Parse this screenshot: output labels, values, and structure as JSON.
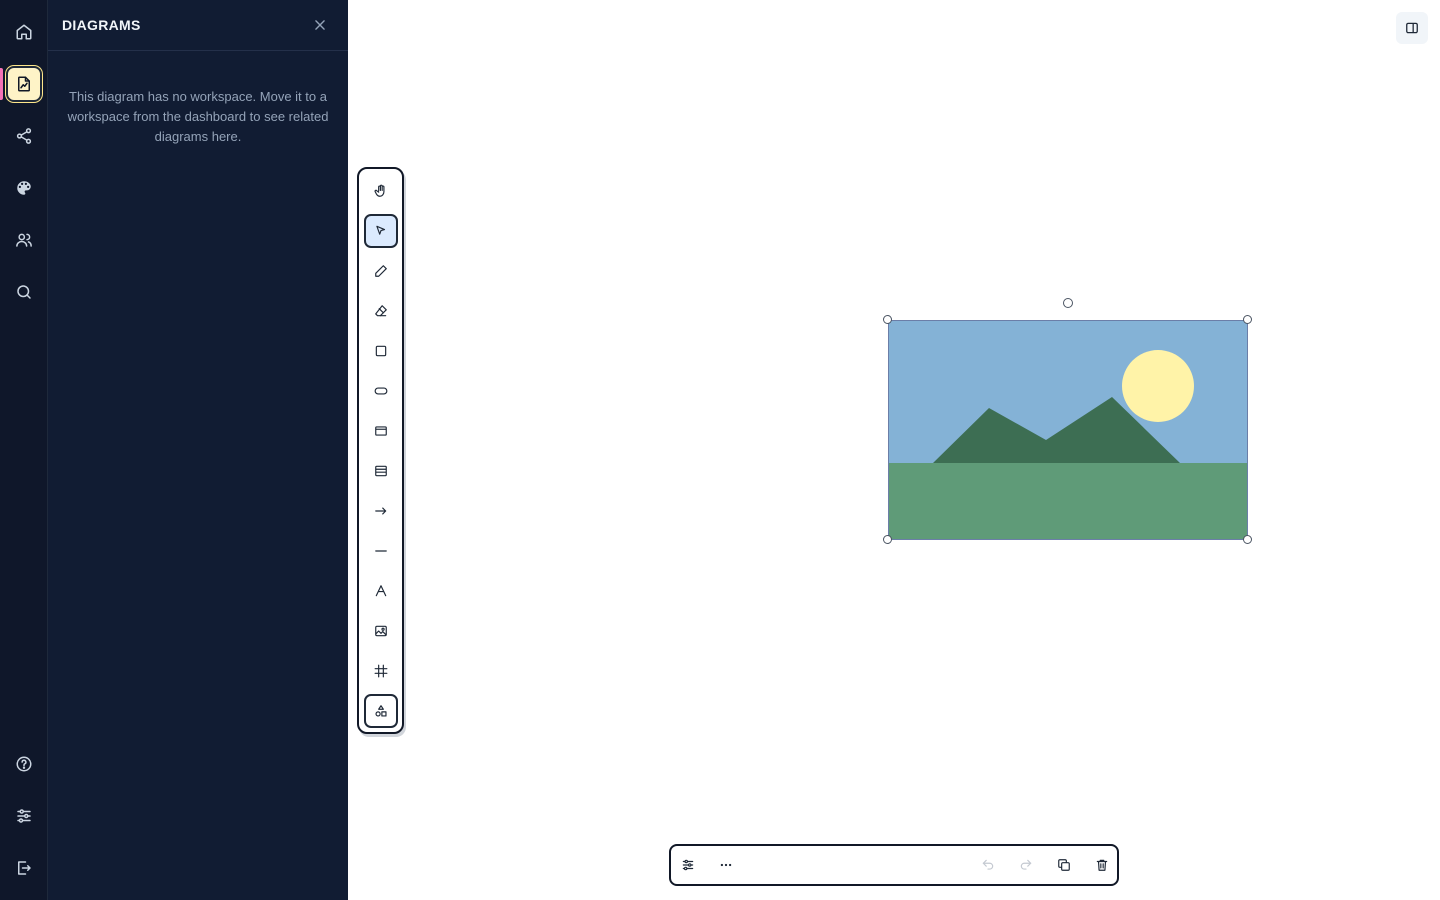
{
  "panel": {
    "title": "DIAGRAMS",
    "message": "This diagram has no workspace. Move it to a workspace from the dashboard to see related diagrams here."
  },
  "rail": {
    "items": [
      {
        "icon": "home-icon"
      },
      {
        "icon": "diagram-icon",
        "active": true
      },
      {
        "icon": "share-icon"
      },
      {
        "icon": "palette-icon"
      },
      {
        "icon": "users-icon"
      },
      {
        "icon": "search-icon"
      },
      {
        "icon": "help-icon"
      },
      {
        "icon": "settings-sliders-icon"
      },
      {
        "icon": "logout-icon"
      }
    ]
  },
  "toolbar": {
    "tools": [
      {
        "name": "hand",
        "icon": "hand-icon"
      },
      {
        "name": "select",
        "icon": "pointer-icon",
        "selected": true
      },
      {
        "name": "pencil",
        "icon": "pencil-icon"
      },
      {
        "name": "eraser",
        "icon": "eraser-icon"
      },
      {
        "name": "rectangle",
        "icon": "square-icon"
      },
      {
        "name": "ellipse",
        "icon": "ellipse-icon"
      },
      {
        "name": "card",
        "icon": "card-icon"
      },
      {
        "name": "table",
        "icon": "table-icon"
      },
      {
        "name": "arrow",
        "icon": "arrow-right-icon"
      },
      {
        "name": "line",
        "icon": "line-icon"
      },
      {
        "name": "text",
        "icon": "text-icon",
        "glyph": "A"
      },
      {
        "name": "image",
        "icon": "image-icon"
      },
      {
        "name": "frame",
        "icon": "frame-icon"
      },
      {
        "name": "shapes",
        "icon": "shapes-icon"
      }
    ]
  },
  "colors": {
    "sky": "#84b2d6",
    "ground": "#5f9b78",
    "mountain": "#3d6e53",
    "sun": "#fff3a8"
  }
}
